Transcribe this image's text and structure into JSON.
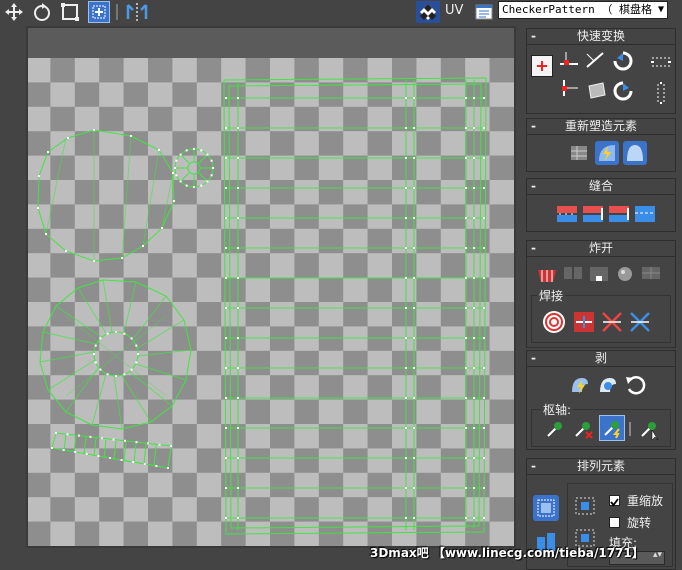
{
  "toolbar": {
    "uv_label": "UV",
    "map_select_value": "CheckerPattern （ 棋盘格",
    "icons": [
      "move-icon",
      "rotate-icon",
      "scale-icon",
      "freeform-icon",
      "mirror-icon",
      "checker-toggle-icon",
      "uv-options-icon"
    ]
  },
  "panel": {
    "quick_transform": {
      "title": "快速变换",
      "collapse": "-"
    },
    "reshape": {
      "title": "重新塑造元素",
      "collapse": "-"
    },
    "stitch": {
      "title": "缝合",
      "collapse": "-"
    },
    "explode": {
      "title": "炸开",
      "collapse": "-",
      "weld_label": "焊接"
    },
    "peel": {
      "title": "剥",
      "collapse": "-",
      "pivot_label": "枢轴:"
    },
    "arrange": {
      "title": "排列元素",
      "collapse": "-",
      "rescale_label": "重缩放",
      "rescale_checked": true,
      "rotate_label": "旋转",
      "rotate_checked": false,
      "padding_label": "填充:"
    }
  },
  "watermark": "3Dmax吧 【www.linecg.com/tieba/1771】",
  "colors": {
    "checker_light": "#bdbdbd",
    "checker_dark": "#8e8e8e",
    "uv_wire": "#3fe63f",
    "panel_bg": "#444444",
    "accent_blue": "#3a73c9"
  }
}
